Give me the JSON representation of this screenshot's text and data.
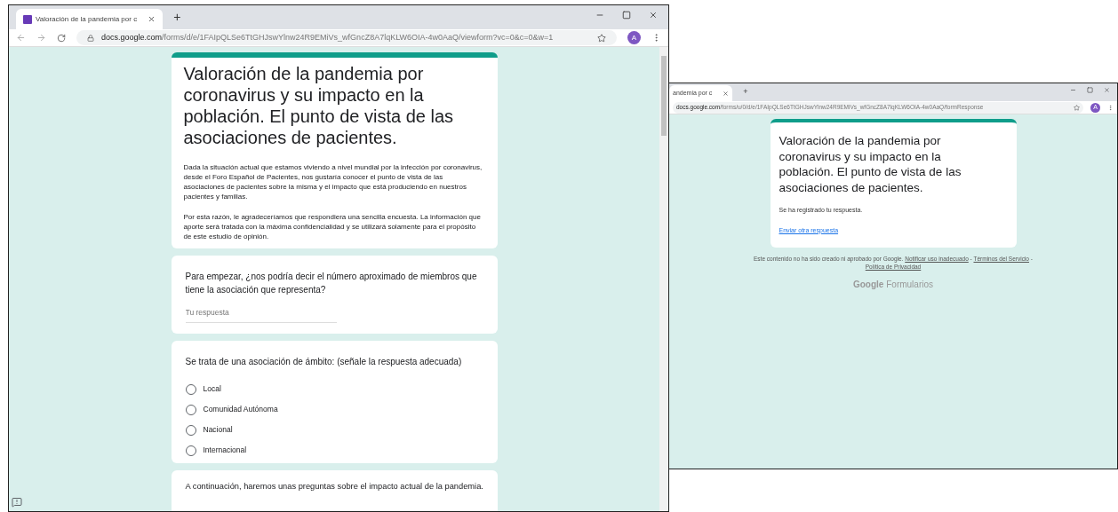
{
  "left_window": {
    "tab": {
      "title": "Valoración de la pandemia por c",
      "selected": true
    },
    "new_tab": "+",
    "url_host": "docs.google.com",
    "url_path": "/forms/d/e/1FAIpQLSe6TtGHJswYlnw24R9EMiVs_wfGncZ8A7lqKLW6OIA-4w0AaQ/viewform?vc=0&c=0&w=1",
    "avatar": "A",
    "form": {
      "title": "Valoración de la pandemia por coronavirus y su impacto en la población. El punto de vista de las asociaciones de pacientes.",
      "description": [
        "Dada la situación actual que estamos viviendo a nivel mundial por la infección por coronavirus, desde el Foro Español de Pacientes, nos gustaría conocer el punto de vista de las asociaciones de pacientes sobre la misma y el impacto que está produciendo en nuestros pacientes y familias.",
        "Por esta razón, le agradeceríamos que respondiera una sencilla encuesta. La información que aporte será tratada con la máxima confidencialidad y se utilizará solamente para el propósito de este estudio de opinión."
      ],
      "questions": [
        {
          "kind": "text",
          "question": "Para empezar, ¿nos podría decir el número aproximado de miembros que tiene la asociación que representa?",
          "placeholder": "Tu respuesta"
        },
        {
          "kind": "radio",
          "question": "Se trata de una asociación de ámbito: (señale la respuesta adecuada)",
          "options": [
            {
              "label": "Local",
              "selected": false
            },
            {
              "label": "Comunidad Autónoma",
              "selected": false
            },
            {
              "label": "Nacional",
              "selected": false
            },
            {
              "label": "Internacional",
              "selected": false
            }
          ]
        },
        {
          "kind": "section",
          "question": "A continuación, haremos unas preguntas sobre el impacto actual de la pandemia."
        }
      ]
    }
  },
  "right_window": {
    "tab": {
      "title": "andemia por c",
      "selected": true
    },
    "new_tab": "+",
    "url_host": "docs.google.com",
    "url_path": "/forms/u/0/d/e/1FAIpQLSe6TtGHJswYlnw24R9EMiVs_wfGncZ8A7lqKLW6OIA-4w0AaQ/formResponse",
    "avatar": "A",
    "form": {
      "title": "Valoración de la pandemia por coronavirus y su impacto en la población. El punto de vista de las asociaciones de pacientes.",
      "confirmation": "Se ha registrado tu respuesta.",
      "another_link": "Enviar otra respuesta",
      "footer": {
        "text": "Este contenido no ha sido creado ni aprobado por Google.",
        "links": [
          "Notificar uso inadecuado",
          "Términos del Servicio",
          "Política de Privacidad"
        ],
        "separator": "-"
      },
      "brand": {
        "google": "Google",
        "product": "Formularios"
      }
    }
  }
}
